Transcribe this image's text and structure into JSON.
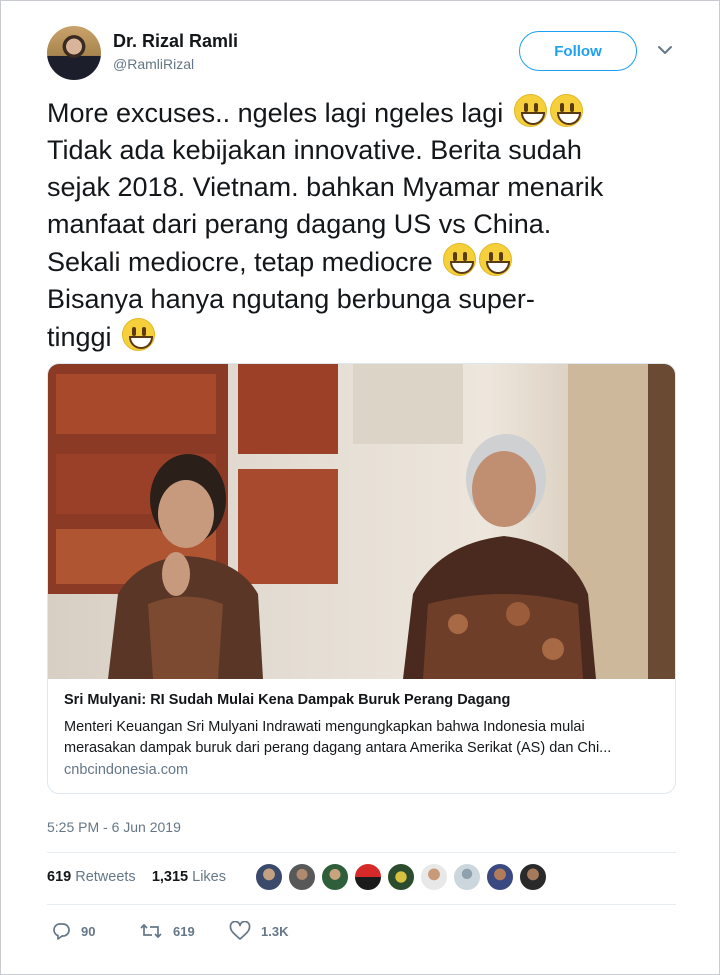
{
  "author": {
    "name": "Dr. Rizal Ramli",
    "handle": "@RamliRizal",
    "follow_label": "Follow"
  },
  "tweet": {
    "lines": [
      "More excuses.. ngeles lagi ngeles lagi",
      "Tidak ada kebijakan innovative. Berita sudah",
      "sejak 2018. Vietnam. bahkan Myamar menarik",
      "manfaat dari perang dagang US vs China.",
      "Sekali mediocre, tetap mediocre",
      "Bisanya hanya ngutang berbunga super-",
      "tinggi"
    ],
    "emoji_name": "grinning-face-emoji"
  },
  "card": {
    "title": "Sri Mulyani: RI Sudah Mulai Kena Dampak Buruk Perang Dagang",
    "description_line1": "Menteri Keuangan Sri Mulyani Indrawati mengungkapkan bahwa Indonesia mulai",
    "description_line2": "merasakan dampak buruk dari perang dagang antara Amerika Serikat (AS) dan Chi...",
    "domain": "cnbcindonesia.com"
  },
  "timestamp": "5:25 PM - 6 Jun 2019",
  "stats": {
    "retweets_count": "619",
    "retweets_label": "Retweets",
    "likes_count": "1,315",
    "likes_label": "Likes"
  },
  "actions": {
    "replies": "90",
    "retweets": "619",
    "likes": "1.3K"
  },
  "colors": {
    "accent": "#1da1f2",
    "text": "#14171a",
    "secondary": "#657786"
  },
  "icons": [
    "chevron-down-icon",
    "reply-icon",
    "retweet-icon",
    "heart-icon"
  ]
}
